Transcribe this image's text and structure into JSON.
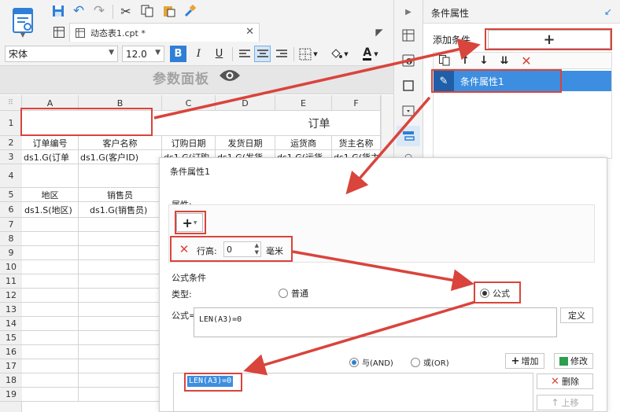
{
  "toolbar": {
    "font_name": "宋体",
    "font_size": "12.0",
    "bold": "B",
    "italic": "I",
    "underline": "U"
  },
  "tab": {
    "title": "动态表1.cpt *"
  },
  "param_panel": {
    "title": "参数面板"
  },
  "sheet": {
    "columns": [
      "A",
      "B",
      "C",
      "D",
      "E",
      "F"
    ],
    "rows": [
      "1",
      "2",
      "3",
      "4",
      "5",
      "6",
      "7",
      "8",
      "9",
      "10",
      "11",
      "12",
      "13",
      "14",
      "15",
      "16",
      "17",
      "18",
      "19"
    ],
    "title_cell": "订单",
    "row2": [
      "订单编号",
      "客户名称",
      "订购日期",
      "发货日期",
      "运货商",
      "货主名称"
    ],
    "row3": [
      "ds1.G(订单",
      "ds1.G(客户ID)",
      "ds1.G(订购",
      "ds1.G(发货",
      "ds1.G(运货",
      "ds1.G(货主"
    ],
    "row5": [
      "地区",
      "销售员"
    ],
    "row6": [
      "ds1.S(地区)",
      "ds1.G(销售员)"
    ]
  },
  "right_panel": {
    "title": "条件属性",
    "add_label": "添加条件",
    "add_symbol": "+",
    "list_item": "条件属性1"
  },
  "dialog": {
    "title": "条件属性1",
    "property_label": "属性:",
    "row_height_label": "行高:",
    "row_height_value": "0",
    "unit": "毫米",
    "formula_section": "公式条件",
    "type_label": "类型:",
    "type_normal": "普通",
    "type_formula": "公式",
    "formula_label": "公式=",
    "formula_value": "LEN(A3)=0",
    "define_button": "定义",
    "and_label": "与(AND)",
    "or_label": "或(OR)",
    "add_button": "增加",
    "modify_button": "修改",
    "delete_button": "删除",
    "up_button": "上移",
    "condition_item": "LEN(A3)=0"
  },
  "colors": {
    "accent": "#2f7fd6",
    "selection": "#3d8ee0",
    "annotation": "#d9443c"
  }
}
